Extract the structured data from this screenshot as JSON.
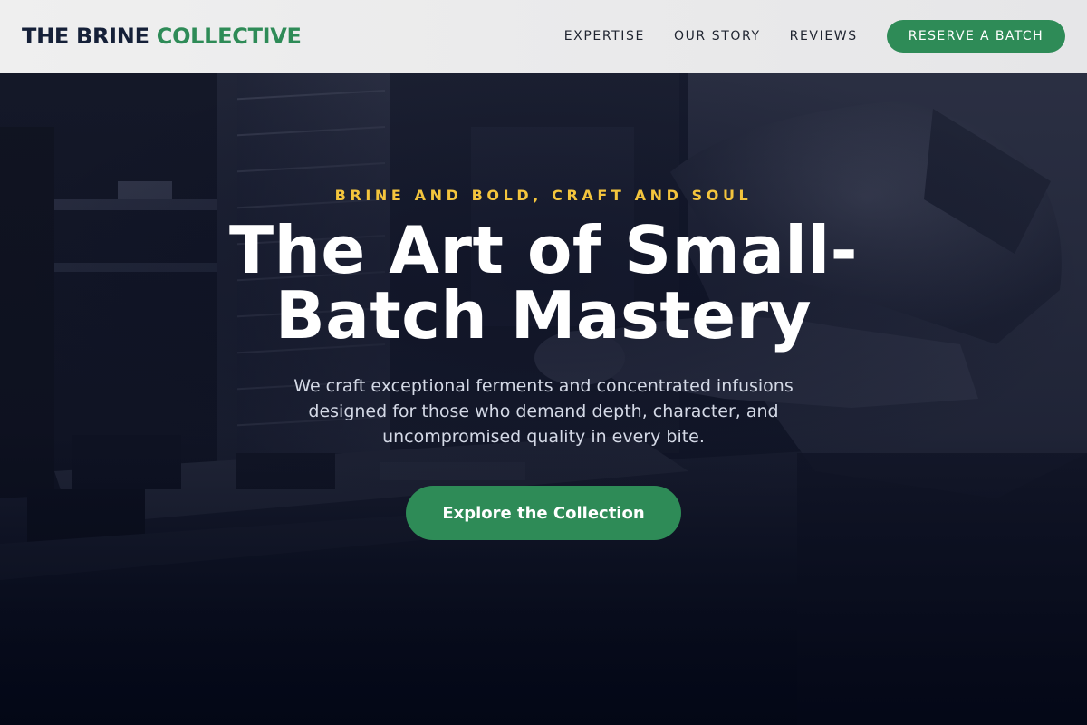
{
  "header": {
    "brand_main": "THE BRINE",
    "brand_accent": "COLLECTIVE",
    "nav": [
      {
        "label": "EXPERTISE"
      },
      {
        "label": "OUR STORY"
      },
      {
        "label": "REVIEWS"
      }
    ],
    "cta_label": "RESERVE A BATCH"
  },
  "hero": {
    "eyebrow": "BRINE AND BOLD, CRAFT AND SOUL",
    "headline": "The Art of Small-Batch Mastery",
    "subhead": "We craft exceptional ferments and concentrated infusions designed for those who demand depth, character, and uncompromised quality in every bite.",
    "cta_label": "Explore the Collection",
    "background_image": "workshop-craftsman-photo"
  },
  "colors": {
    "brand_dark": "#152038",
    "accent_green": "#2e8b57",
    "eyebrow_gold": "#f4c53d",
    "hero_bg": "#050a1a"
  }
}
